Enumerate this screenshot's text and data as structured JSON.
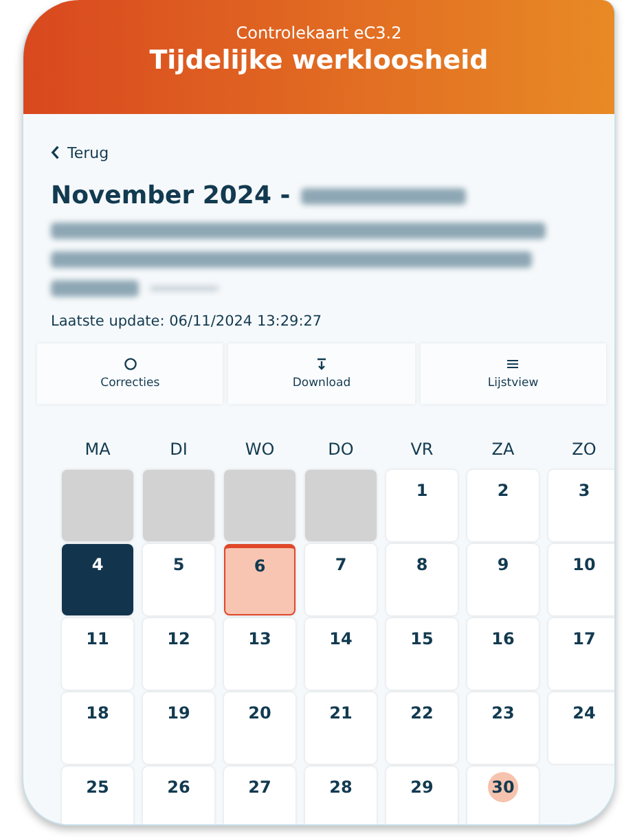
{
  "header": {
    "subtitle": "Controlekaart eC3.2",
    "title": "Tijdelijke werkloosheid"
  },
  "back": {
    "label": "Terug"
  },
  "heading": {
    "title": "November 2024 -"
  },
  "last_update": "Laatste update: 06/11/2024 13:29:27",
  "actions": [
    {
      "label": "Correcties",
      "kind": "refresh"
    },
    {
      "label": "Download",
      "kind": "download"
    },
    {
      "label": "Lijstview",
      "kind": "list"
    }
  ],
  "weekdays": [
    "MA",
    "DI",
    "WO",
    "DO",
    "VR",
    "ZA",
    "ZO"
  ],
  "days": [
    {
      "kind": "blank"
    },
    {
      "kind": "blank"
    },
    {
      "kind": "blank"
    },
    {
      "kind": "blank"
    },
    {
      "kind": "day",
      "label": "1",
      "selected": false,
      "flagged": false,
      "circled": false
    },
    {
      "kind": "day",
      "label": "2",
      "selected": false,
      "flagged": false,
      "circled": false
    },
    {
      "kind": "day",
      "label": "3",
      "selected": false,
      "flagged": false,
      "circled": false
    },
    {
      "kind": "day",
      "label": "4",
      "selected": true,
      "flagged": false,
      "circled": false
    },
    {
      "kind": "day",
      "label": "5",
      "selected": false,
      "flagged": false,
      "circled": false
    },
    {
      "kind": "day",
      "label": "6",
      "selected": false,
      "flagged": true,
      "circled": false
    },
    {
      "kind": "day",
      "label": "7",
      "selected": false,
      "flagged": false,
      "circled": false
    },
    {
      "kind": "day",
      "label": "8",
      "selected": false,
      "flagged": false,
      "circled": false
    },
    {
      "kind": "day",
      "label": "9",
      "selected": false,
      "flagged": false,
      "circled": false
    },
    {
      "kind": "day",
      "label": "10",
      "selected": false,
      "flagged": false,
      "circled": false
    },
    {
      "kind": "day",
      "label": "11",
      "selected": false,
      "flagged": false,
      "circled": false
    },
    {
      "kind": "day",
      "label": "12",
      "selected": false,
      "flagged": false,
      "circled": false
    },
    {
      "kind": "day",
      "label": "13",
      "selected": false,
      "flagged": false,
      "circled": false
    },
    {
      "kind": "day",
      "label": "14",
      "selected": false,
      "flagged": false,
      "circled": false
    },
    {
      "kind": "day",
      "label": "15",
      "selected": false,
      "flagged": false,
      "circled": false
    },
    {
      "kind": "day",
      "label": "16",
      "selected": false,
      "flagged": false,
      "circled": false
    },
    {
      "kind": "day",
      "label": "17",
      "selected": false,
      "flagged": false,
      "circled": false
    },
    {
      "kind": "day",
      "label": "18",
      "selected": false,
      "flagged": false,
      "circled": false
    },
    {
      "kind": "day",
      "label": "19",
      "selected": false,
      "flagged": false,
      "circled": false
    },
    {
      "kind": "day",
      "label": "20",
      "selected": false,
      "flagged": false,
      "circled": false
    },
    {
      "kind": "day",
      "label": "21",
      "selected": false,
      "flagged": false,
      "circled": false
    },
    {
      "kind": "day",
      "label": "22",
      "selected": false,
      "flagged": false,
      "circled": false
    },
    {
      "kind": "day",
      "label": "23",
      "selected": false,
      "flagged": false,
      "circled": false
    },
    {
      "kind": "day",
      "label": "24",
      "selected": false,
      "flagged": false,
      "circled": false
    },
    {
      "kind": "day",
      "label": "25",
      "selected": false,
      "flagged": false,
      "circled": false
    },
    {
      "kind": "day",
      "label": "26",
      "selected": false,
      "flagged": false,
      "circled": false
    },
    {
      "kind": "day",
      "label": "27",
      "selected": false,
      "flagged": false,
      "circled": false
    },
    {
      "kind": "day",
      "label": "28",
      "selected": false,
      "flagged": false,
      "circled": false
    },
    {
      "kind": "day",
      "label": "29",
      "selected": false,
      "flagged": false,
      "circled": false
    },
    {
      "kind": "day",
      "label": "30",
      "selected": false,
      "flagged": false,
      "circled": true
    }
  ]
}
